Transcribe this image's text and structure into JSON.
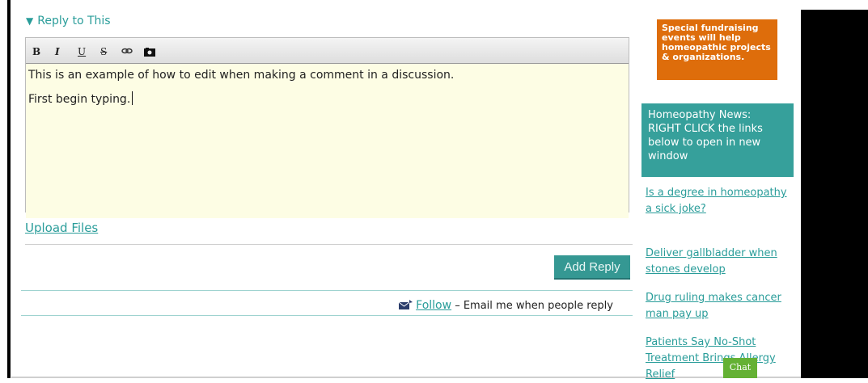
{
  "reply_section": {
    "title": "Reply to This",
    "toggle_icon": "triangle-down",
    "toolbar": {
      "bold": "B",
      "italic": "I",
      "underline": "U",
      "strikethrough": "S",
      "link_icon": "link-icon",
      "photo_icon": "camera-icon"
    },
    "editor_lines": [
      "This is an example of how to edit when making a comment in a discussion.",
      "First begin typing."
    ],
    "upload_label": "Upload Files",
    "add_reply_label": "Add Reply",
    "follow_link": "Follow",
    "follow_text": "– Email me when people reply"
  },
  "sidebar": {
    "promo_text": "Special fundraising events will help homeopathic projects & organizations.",
    "news_heading": "Homeopathy News: RIGHT CLICK the links below to open in new window",
    "news_links": [
      "Is a degree in homeopathy a sick joke?",
      "Deliver gallbladder when stones develop",
      "Drug ruling makes cancer man pay up",
      "Patients Say No-Shot Treatment Brings Allergy Relief"
    ]
  },
  "chat_label": "Chat",
  "colors": {
    "accent": "#2a9d9a",
    "button": "#359893",
    "promo": "#de6d0b",
    "chat": "#64b134",
    "editor_bg": "#fdfde4"
  }
}
